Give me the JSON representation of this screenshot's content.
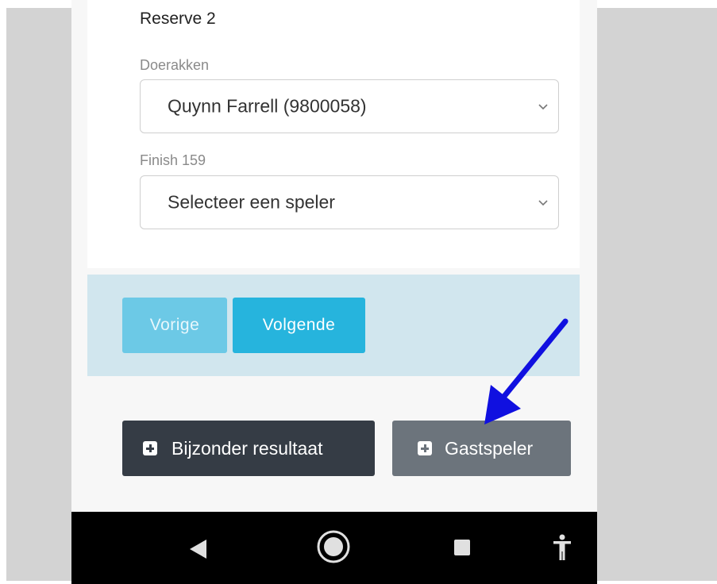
{
  "form": {
    "section_title": "Reserve 2",
    "fields": [
      {
        "label": "Doerakken",
        "selected": "Quynn Farrell (9800058)"
      },
      {
        "label": "Finish 159",
        "selected": "Selecteer een speler"
      }
    ]
  },
  "nav_buttons": {
    "prev_label": "Vorige",
    "next_label": "Volgende"
  },
  "action_buttons": {
    "special_result_label": "Bijzonder resultaat",
    "guest_player_label": "Gastspeler"
  },
  "system_nav": {
    "back": "back-icon",
    "home": "home-icon",
    "recents": "recents-icon",
    "accessibility": "accessibility-icon"
  },
  "annotation": {
    "arrow_color": "#1010e0"
  }
}
